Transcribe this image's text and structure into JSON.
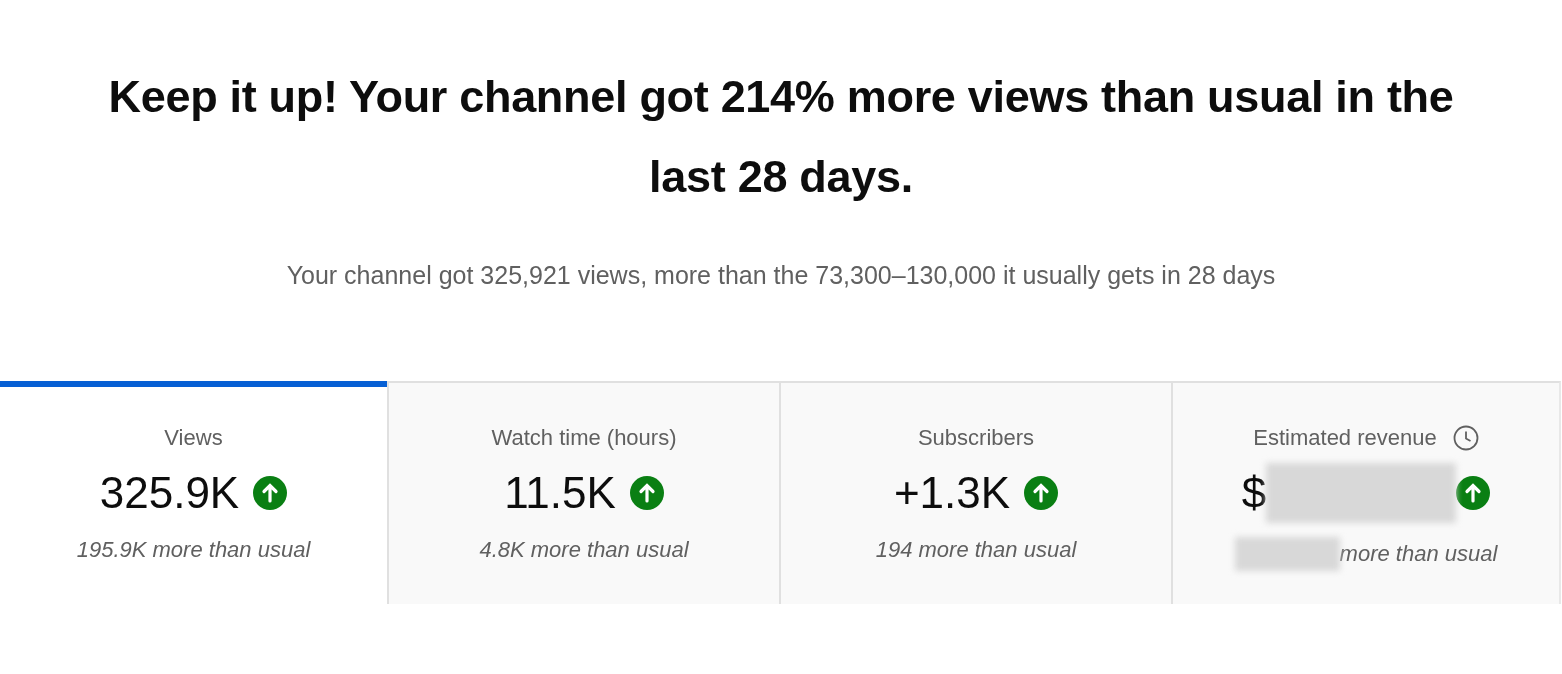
{
  "headline": "Keep it up! Your channel got 214% more views than usual in the last 28 days.",
  "summary": "Your channel got 325,921 views, more than the 73,300–130,000 it usually gets in 28 days",
  "tabs": [
    {
      "label": "Views",
      "value": "325.9K",
      "rising": true,
      "delta": "195.9K more than usual",
      "selected": true,
      "redacted": false,
      "clock": false
    },
    {
      "label": "Watch time (hours)",
      "value": "11.5K",
      "rising": true,
      "delta": "4.8K more than usual",
      "selected": false,
      "redacted": false,
      "clock": false
    },
    {
      "label": "Subscribers",
      "value": "+1.3K",
      "rising": true,
      "delta": "194 more than usual",
      "selected": false,
      "redacted": false,
      "clock": false
    },
    {
      "label": "Estimated revenue",
      "value": "$",
      "rising": true,
      "delta": "more than usual",
      "selected": false,
      "redacted": true,
      "clock": true
    }
  ]
}
